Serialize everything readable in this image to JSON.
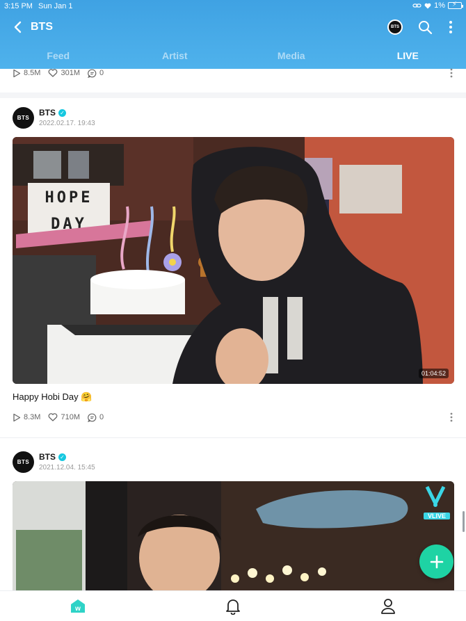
{
  "status_bar": {
    "time": "3:15 PM",
    "date": "Sun Jan 1",
    "battery": "1%"
  },
  "header": {
    "title": "BTS",
    "avatar_text": "BTS",
    "tabs": [
      {
        "label": "Feed",
        "active": false
      },
      {
        "label": "Artist",
        "active": false
      },
      {
        "label": "Media",
        "active": false
      },
      {
        "label": "LIVE",
        "active": true
      }
    ]
  },
  "posts": [
    {
      "plays": "8.5M",
      "likes": "301M",
      "comments": "0"
    },
    {
      "author": "BTS",
      "avatar_text": "BTS",
      "date": "2022.02.17. 19:43",
      "duration": "01:04:52",
      "caption": "Happy Hobi Day 🤗",
      "plays": "8.3M",
      "likes": "710M",
      "comments": "0",
      "sign_hope": "HOPE",
      "sign_day": "DAY"
    },
    {
      "author": "BTS",
      "avatar_text": "BTS",
      "date": "2021.12.04. 15:45",
      "badge": "VLIVE"
    }
  ],
  "colors": {
    "header_gradient_start": "#3fa2e3",
    "header_gradient_end": "#4fb2ec",
    "fab": "#1ed3a4",
    "verified": "#16c8e0",
    "weverse_icon": "#2fd3c7"
  },
  "icons": {
    "back": "chevron-left-icon",
    "search": "search-icon",
    "more": "more-vertical-icon",
    "play": "play-icon",
    "heart": "heart-icon",
    "comment": "comment-icon",
    "add": "plus-icon",
    "home": "weverse-home-icon",
    "notifications": "bell-icon",
    "profile": "user-icon"
  }
}
